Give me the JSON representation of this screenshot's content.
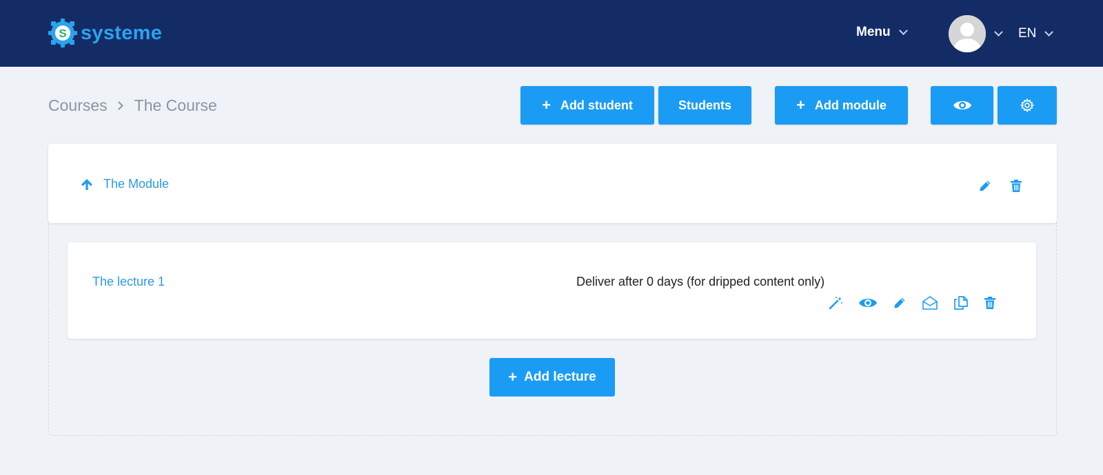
{
  "header": {
    "logo_text": "systeme",
    "logo_icon": "systeme-gear-logo",
    "menu_label": "Menu",
    "language": "EN"
  },
  "breadcrumb": {
    "root": "Courses",
    "current": "The Course"
  },
  "toolbar": {
    "add_student_label": "Add student",
    "students_label": "Students",
    "add_module_label": "Add module",
    "preview_icon": "eye-icon",
    "settings_icon": "gear-icon"
  },
  "module": {
    "title": "The Module",
    "icons": [
      "arrow-up-icon",
      "pencil-icon",
      "trash-icon"
    ]
  },
  "lecture": {
    "title": "The lecture 1",
    "delivery_text": "Deliver after 0 days (for dripped content only)",
    "icons": [
      "magic-wand-icon",
      "eye-icon",
      "pencil-icon",
      "envelope-open-icon",
      "copy-icon",
      "trash-icon"
    ]
  },
  "add_lecture_label": "Add lecture",
  "colors": {
    "header_bg": "#142c66",
    "accent": "#1b9cf4",
    "link": "#2a9ae6",
    "page_bg": "#eff2f6"
  }
}
